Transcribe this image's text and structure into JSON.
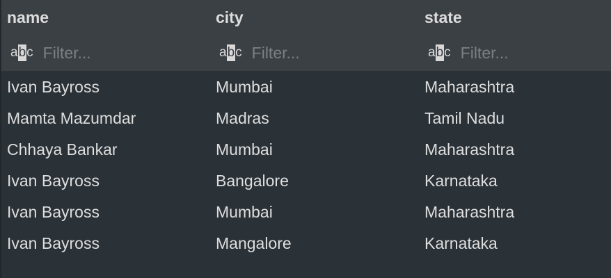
{
  "columns": [
    {
      "label": "name",
      "filter_placeholder": "Filter...",
      "filter_value": ""
    },
    {
      "label": "city",
      "filter_placeholder": "Filter...",
      "filter_value": ""
    },
    {
      "label": "state",
      "filter_placeholder": "Filter...",
      "filter_value": ""
    }
  ],
  "filter_icon_text": {
    "a": "a",
    "b": "b",
    "c": "c"
  },
  "rows": [
    [
      "Ivan Bayross",
      "Mumbai",
      "Maharashtra"
    ],
    [
      "Mamta Mazumdar",
      "Madras",
      "Tamil Nadu"
    ],
    [
      "Chhaya Bankar",
      "Mumbai",
      "Maharashtra"
    ],
    [
      "Ivan Bayross",
      "Bangalore",
      "Karnataka"
    ],
    [
      "Ivan Bayross",
      "Mumbai",
      "Maharashtra"
    ],
    [
      "Ivan Bayross",
      "Mangalore",
      "Karnataka"
    ]
  ]
}
